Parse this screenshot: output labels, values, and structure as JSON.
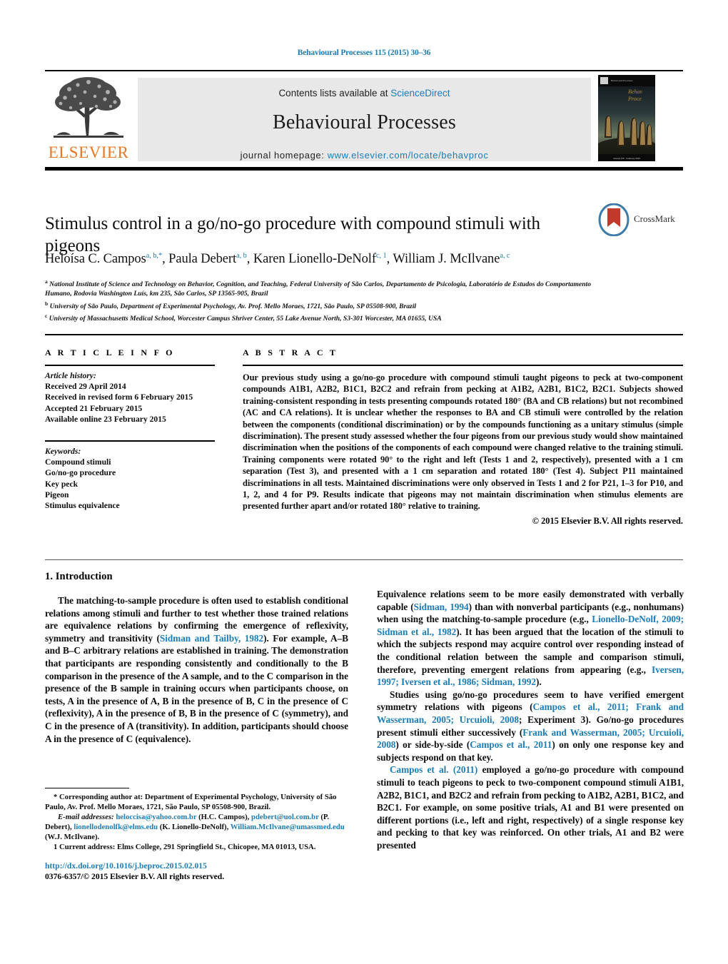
{
  "running_head": "Behavioural Processes 115 (2015) 30–36",
  "masthead": {
    "publisher_name": "ELSEVIER",
    "contents_prefix": "Contents lists available at ",
    "contents_link": "ScienceDirect",
    "journal_title": "Behavioural Processes",
    "homepage_prefix": "journal homepage: ",
    "homepage_url": "www.elsevier.com/locate/behavproc",
    "cover_caption": "Behavioural Processes"
  },
  "article": {
    "title": "Stimulus control in a go/no-go procedure with compound stimuli with pigeons",
    "crossmark_label": "CrossMark",
    "authors_html": "Heloísa C. Campos<sup>a, b,*</sup>, Paula Debert<sup>a, b</sup>, Karen Lionello-DeNolf<sup>c, 1</sup>, William J. McIlvane<sup>a, c</sup>",
    "affiliations": [
      "National Institute of Science and Technology on Behavior, Cognition, and Teaching, Federal University of São Carlos, Departamento de Psicologia, Laboratório de Estudos do Comportamento Humano, Rodovia Washington Luís, km 235, São Carlos, SP 13565-905, Brazil",
      "University of São Paulo, Department of Experimental Psychology, Av. Prof. Mello Moraes, 1721, São Paulo, SP 05508-900, Brazil",
      "University of Massachusetts Medical School, Worcester Campus Shriver Center, 55 Lake Avenue North, S3-301 Worcester, MA 01655, USA"
    ],
    "affiliation_marks": [
      "a",
      "b",
      "c"
    ]
  },
  "article_info": {
    "heading": "A R T I C L E    I N F O",
    "history_label": "Article history:",
    "history": [
      "Received 29 April 2014",
      "Received in revised form 6 February 2015",
      "Accepted 21 February 2015",
      "Available online 23 February 2015"
    ],
    "keywords_label": "Keywords:",
    "keywords": [
      "Compound stimuli",
      "Go/no-go procedure",
      "Key peck",
      "Pigeon",
      "Stimulus equivalence"
    ]
  },
  "abstract": {
    "heading": "A B S T R A C T",
    "text": "Our previous study using a go/no-go procedure with compound stimuli taught pigeons to peck at two-component compounds A1B1, A2B2, B1C1, B2C2 and refrain from pecking at A1B2, A2B1, B1C2, B2C1. Subjects showed training-consistent responding in tests presenting compounds rotated 180° (BA and CB relations) but not recombined (AC and CA relations). It is unclear whether the responses to BA and CB stimuli were controlled by the relation between the components (conditional discrimination) or by the compounds functioning as a unitary stimulus (simple discrimination). The present study assessed whether the four pigeons from our previous study would show maintained discrimination when the positions of the components of each compound were changed relative to the training stimuli. Training components were rotated 90° to the right and left (Tests 1 and 2, respectively), presented with a 1 cm separation (Test 3), and presented with a 1 cm separation and rotated 180° (Test 4). Subject P11 maintained discriminations in all tests. Maintained discriminations were only observed in Tests 1 and 2 for P21, 1–3 for P10, and 1, 2, and 4 for P9. Results indicate that pigeons may not maintain discrimination when stimulus elements are presented further apart and/or rotated 180° relative to training.",
    "copyright": "© 2015 Elsevier B.V. All rights reserved."
  },
  "introduction": {
    "heading": "1.  Introduction",
    "left_paragraphs": [
      {
        "segments": [
          {
            "t": "The matching-to-sample procedure is often used to establish conditional relations among stimuli and further to test whether those trained relations are equivalence relations by confirming the emergence of reflexivity, symmetry and transitivity (",
            "ref": false
          },
          {
            "t": "Sidman and Tailby, 1982",
            "ref": true
          },
          {
            "t": "). For example, A–B and B–C arbitrary relations are established in training. The demonstration that participants are responding consistently and conditionally to the B comparison in the presence of the A sample, and to the C comparison in the presence of the B sample in training occurs when participants choose, on tests, A in the presence of A, B in the presence of B, C in the presence of C (reflexivity), A in the presence of B, B in the presence of C (symmetry), and C in the presence of A (transitivity). In addition, participants should choose A in the presence of C (equivalence).",
            "ref": false
          }
        ]
      }
    ],
    "right_paragraphs": [
      {
        "segments": [
          {
            "t": "Equivalence relations seem to be more easily demonstrated with verbally capable (",
            "ref": false
          },
          {
            "t": "Sidman, 1994",
            "ref": true
          },
          {
            "t": ") than with nonverbal participants (e.g., nonhumans) when using the matching-to-sample procedure (e.g., ",
            "ref": false
          },
          {
            "t": "Lionello-DeNolf, 2009; Sidman et al., 1982",
            "ref": true
          },
          {
            "t": "). It has been argued that the location of the stimuli to which the subjects respond may acquire control over responding instead of the conditional relation between the sample and comparison stimuli, therefore, preventing emergent relations from appearing (e.g., ",
            "ref": false
          },
          {
            "t": "Iversen, 1997; Iversen et al., 1986; Sidman, 1992",
            "ref": true
          },
          {
            "t": ").",
            "ref": false
          }
        ]
      },
      {
        "segments": [
          {
            "t": "Studies using go/no-go procedures seem to have verified emergent symmetry relations with pigeons (",
            "ref": false
          },
          {
            "t": "Campos et al., 2011; Frank and Wasserman, 2005; Urcuioli, 2008",
            "ref": true
          },
          {
            "t": "; Experiment 3). Go/no-go procedures present stimuli either successively (",
            "ref": false
          },
          {
            "t": "Frank and Wasserman, 2005; Urcuioli, 2008",
            "ref": true
          },
          {
            "t": ") or side-by-side (",
            "ref": false
          },
          {
            "t": "Campos et al., 2011",
            "ref": true
          },
          {
            "t": ") on only one response key and subjects respond on that key.",
            "ref": false
          }
        ]
      },
      {
        "segments": [
          {
            "t": "Campos et al. (2011)",
            "ref": true
          },
          {
            "t": " employed a go/no-go procedure with compound stimuli to teach pigeons to peck to two-component compound stimuli A1B1, A2B2, B1C1, and B2C2 and refrain from pecking to A1B2, A2B1, B1C2, and B2C1. For example, on some positive trials, A1 and B1 were presented on different portions (i.e., left and right, respectively) of a single response key and pecking to that key was reinforced. On other trials, A1 and B2 were presented",
            "ref": false
          }
        ]
      }
    ]
  },
  "footnotes": {
    "corresponding": "* Corresponding author at: Department of Experimental Psychology, University of São Paulo, Av. Prof. Mello Moraes, 1721, São Paulo, SP 05508-900, Brazil.",
    "email_label": "E-mail addresses:",
    "emails": [
      {
        "address": "heloccisa@yahoo.com.br",
        "owner": "(H.C. Campos)"
      },
      {
        "address": "pdebert@uol.com.br",
        "owner": "(P. Debert)"
      },
      {
        "address": "lionellodenolfk@elms.edu",
        "owner": "(K. Lionello-DeNolf)"
      },
      {
        "address": "William.McIlvane@umassmed.edu",
        "owner": "(W.J. McIlvane)"
      }
    ],
    "current_address": "1  Current address: Elms College, 291 Springfield St., Chicopee, MA 01013, USA."
  },
  "footer": {
    "doi": "http://dx.doi.org/10.1016/j.beproc.2015.02.015",
    "issn_line": "0376-6357/© 2015 Elsevier B.V. All rights reserved."
  }
}
